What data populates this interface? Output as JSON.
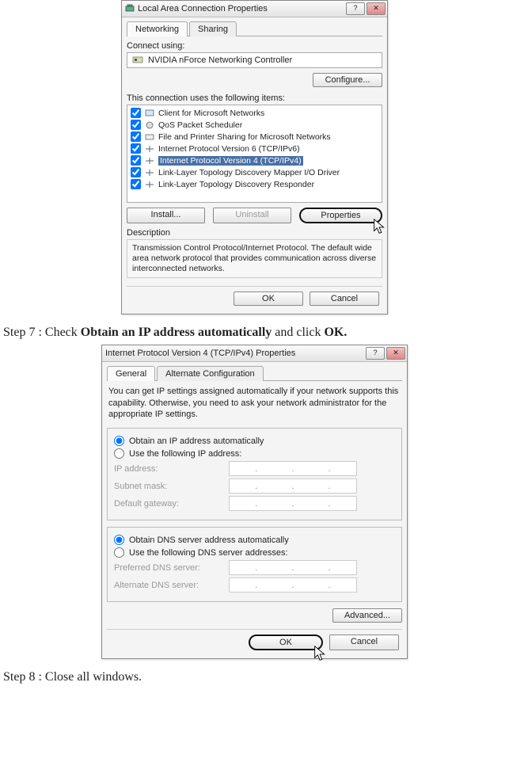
{
  "step7_prefix": "Step 7 : Check ",
  "step7_bold1": "Obtain an IP address automatically",
  "step7_mid": " and click ",
  "step7_bold2": "OK.",
  "step8": "Step 8 : Close all windows.",
  "win1": {
    "title": "Local Area Connection Properties",
    "tabs": {
      "networking": "Networking",
      "sharing": "Sharing"
    },
    "connect_using_label": "Connect using:",
    "adapter": "NVIDIA nForce Networking Controller",
    "configure_btn": "Configure...",
    "items_label": "This connection uses the following items:",
    "items": [
      {
        "label": "Client for Microsoft Networks",
        "selected": false
      },
      {
        "label": "QoS Packet Scheduler",
        "selected": false
      },
      {
        "label": "File and Printer Sharing for Microsoft Networks",
        "selected": false
      },
      {
        "label": "Internet Protocol Version 6 (TCP/IPv6)",
        "selected": false
      },
      {
        "label": "Internet Protocol Version 4 (TCP/IPv4)",
        "selected": true
      },
      {
        "label": "Link-Layer Topology Discovery Mapper I/O Driver",
        "selected": false
      },
      {
        "label": "Link-Layer Topology Discovery Responder",
        "selected": false
      }
    ],
    "install_btn": "Install...",
    "uninstall_btn": "Uninstall",
    "properties_btn": "Properties",
    "desc_label": "Description",
    "desc_text": "Transmission Control Protocol/Internet Protocol. The default wide area network protocol that provides communication across diverse interconnected networks.",
    "ok_btn": "OK",
    "cancel_btn": "Cancel"
  },
  "win2": {
    "title": "Internet Protocol Version 4 (TCP/IPv4) Properties",
    "tabs": {
      "general": "General",
      "alt": "Alternate Configuration"
    },
    "intro": "You can get IP settings assigned automatically if your network supports this capability. Otherwise, you need to ask your network administrator for the appropriate IP settings.",
    "r_auto_ip": "Obtain an IP address automatically",
    "r_manual_ip": "Use the following IP address:",
    "ip_label": "IP address:",
    "subnet_label": "Subnet mask:",
    "gateway_label": "Default gateway:",
    "r_auto_dns": "Obtain DNS server address automatically",
    "r_manual_dns": "Use the following DNS server addresses:",
    "dns1_label": "Preferred DNS server:",
    "dns2_label": "Alternate DNS server:",
    "advanced_btn": "Advanced...",
    "ok_btn": "OK",
    "cancel_btn": "Cancel"
  }
}
